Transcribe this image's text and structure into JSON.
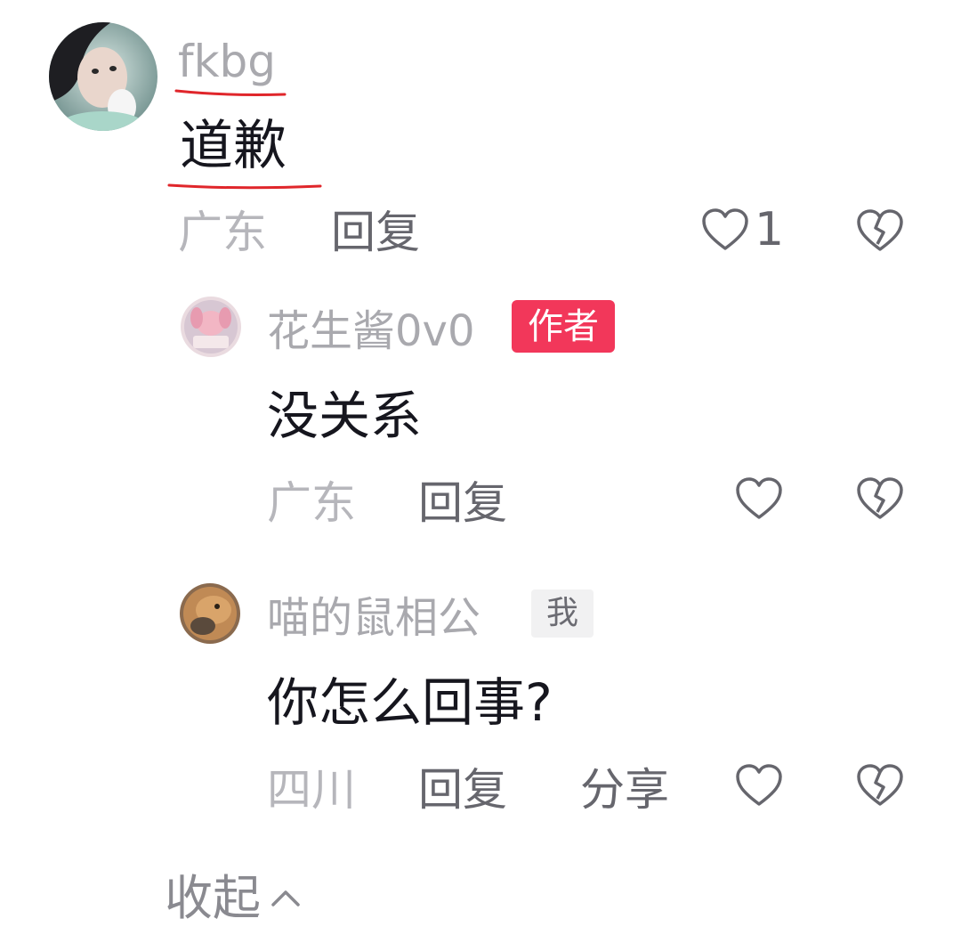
{
  "colors": {
    "author_badge": "#f2375a",
    "annotation_underline": "#e0262b",
    "username": "#a9a9ae",
    "content": "#16161e"
  },
  "comment": {
    "username": "fkbg",
    "content": "道歉",
    "region": "广东",
    "reply_label": "回复",
    "like_count": "1",
    "avatar_icon": "user-avatar-photo",
    "like_icon": "heart-outline-icon",
    "dislike_icon": "broken-heart-icon"
  },
  "replies": [
    {
      "username": "花生酱0v0",
      "badge": "作者",
      "content": "没关系",
      "region": "广东",
      "reply_label": "回复"
    },
    {
      "username": "喵的鼠相公",
      "badge": "我",
      "content": "你怎么回事?",
      "region": "四川",
      "reply_label": "回复",
      "share_label": "分享"
    }
  ],
  "collapse_label": "收起"
}
